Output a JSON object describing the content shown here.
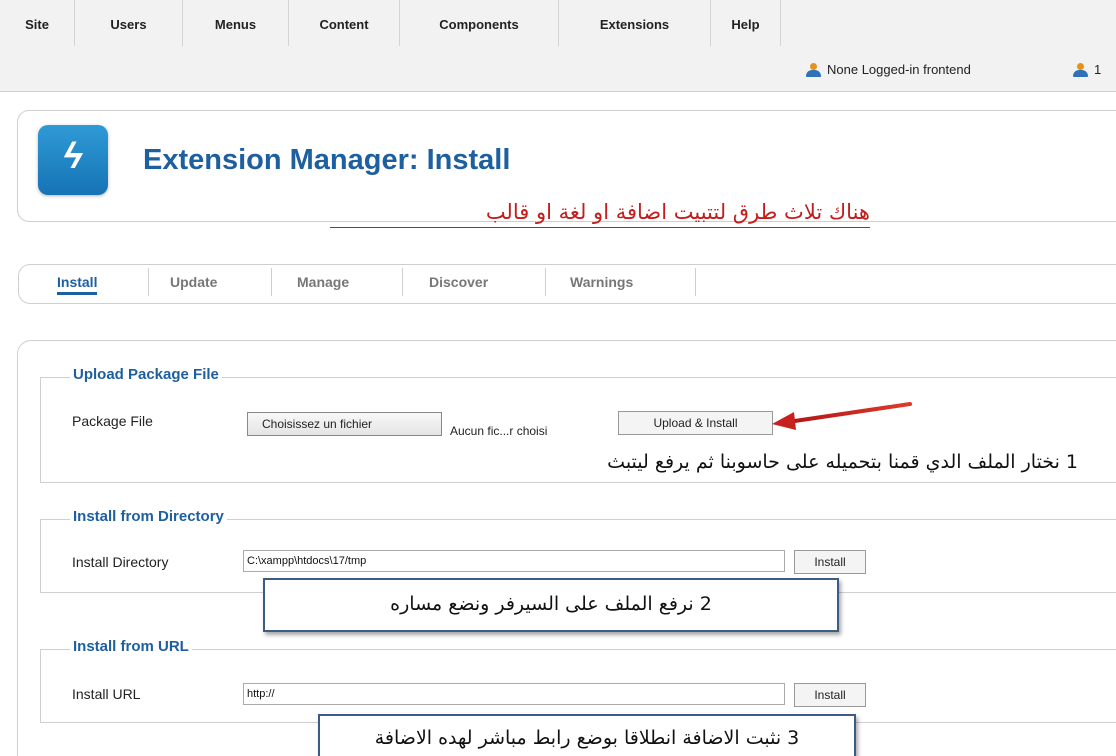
{
  "menu": {
    "items": [
      "Site",
      "Users",
      "Menus",
      "Content",
      "Components",
      "Extensions",
      "Help"
    ]
  },
  "status": {
    "logged_in_text": "None Logged-in frontend",
    "backend_count": "1"
  },
  "header": {
    "logo_glyph": "ϟ",
    "title": "Extension Manager: Install",
    "annotation": "هناك تلاث طرق لتتبيت اضافة او لغة او قالب"
  },
  "subnav": {
    "tabs": [
      "Install",
      "Update",
      "Manage",
      "Discover",
      "Warnings"
    ],
    "active": "Install"
  },
  "upload": {
    "legend": "Upload Package File",
    "label": "Package File",
    "choose_button": "Choisissez un fichier",
    "file_name": "Aucun fic...r choisi",
    "submit_button": "Upload & Install",
    "annotation": "1 نختار الملف الدي قمنا بتحميله على حاسوبنا ثم يرفع ليتبث"
  },
  "directory": {
    "legend": "Install from Directory",
    "label": "Install Directory",
    "value": "C:\\xampp\\htdocs\\17/tmp",
    "button": "Install",
    "annotation": "2 نرفع الملف على السيرفر ونضع مساره"
  },
  "url": {
    "legend": "Install from URL",
    "label": "Install URL",
    "value": "http://",
    "button": "Install",
    "annotation": "3 نثبت الاضافة انطلاقا بوضع رابط مباشر لهده الاضافة"
  },
  "colors": {
    "brand_blue": "#1e5fa0",
    "annotation_red": "#c41d1d",
    "arrow_red": "#c8201e"
  },
  "icons": {
    "user": "user-icon",
    "logo": "lightning-bolt-icon",
    "arrow": "red-arrow-icon"
  }
}
